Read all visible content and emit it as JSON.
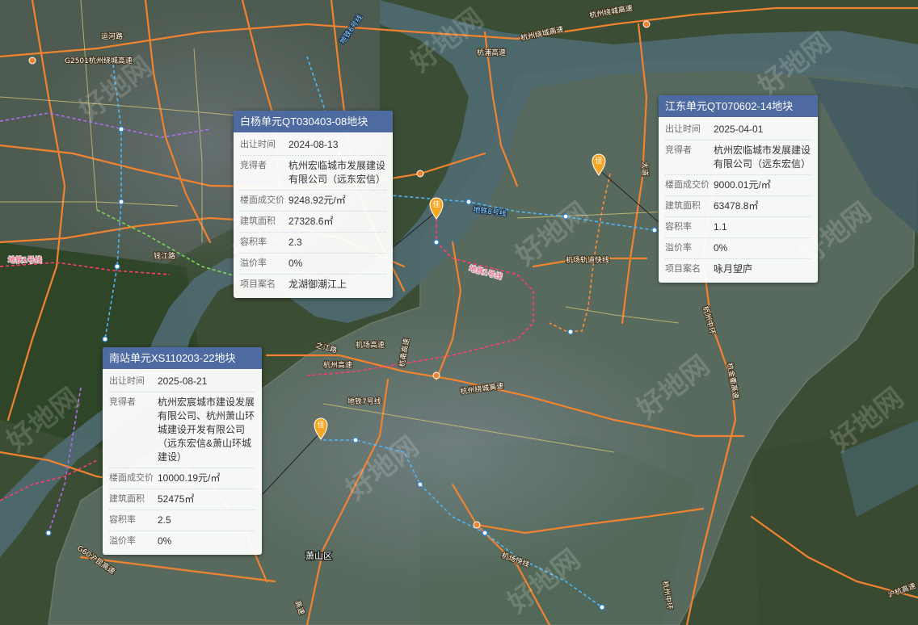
{
  "map": {
    "watermark_text": "好地网",
    "district_label": "萧山区",
    "road_labels": [
      "运河路",
      "G2501杭州绕城高速",
      "杭州绕城高速",
      "杭浦高速",
      "杭州绕城高速",
      "大道",
      "之江路",
      "机场高速",
      "机场轨道快线",
      "杭州高速",
      "杭甬高速",
      "杭州绕城高速",
      "地铁7号线",
      "钱江路",
      "杭州中环",
      "杭金衢高速",
      "机场快线",
      "G60沪昆高速",
      "杭州中环",
      "高速",
      "沪杭高速"
    ],
    "rail_labels": [
      "地铁1号线",
      "地铁1号线"
    ],
    "metro_labels": [
      "地铁8号线",
      "地铁6号线"
    ],
    "pin_glyph": "佳",
    "colors": {
      "highway": "#f0832f",
      "metro_pink": "#ff3d6e",
      "metro_blue": "#4fb7f5",
      "popup_header": "#4d6aa1"
    }
  },
  "popups": {
    "baiyang": {
      "title": "白杨单元QT030403-08地块",
      "rows": [
        {
          "label": "出让时间",
          "value": "2024-08-13"
        },
        {
          "label": "竞得者",
          "value": "杭州宏临城市发展建设有限公司（远东宏信）"
        },
        {
          "label": "楼面成交价",
          "value": "9248.92元/㎡"
        },
        {
          "label": "建筑面积",
          "value": "27328.6㎡"
        },
        {
          "label": "容积率",
          "value": "2.3"
        },
        {
          "label": "溢价率",
          "value": "0%"
        },
        {
          "label": "项目案名",
          "value": "龙湖御潮江上"
        }
      ]
    },
    "jiangdong": {
      "title": "江东单元QT070602-14地块",
      "rows": [
        {
          "label": "出让时间",
          "value": "2025-04-01"
        },
        {
          "label": "竞得者",
          "value": "杭州宏临城市发展建设有限公司（远东宏信）"
        },
        {
          "label": "楼面成交价",
          "value": "9000.01元/㎡"
        },
        {
          "label": "建筑面积",
          "value": "63478.8㎡"
        },
        {
          "label": "容积率",
          "value": "1.1"
        },
        {
          "label": "溢价率",
          "value": "0%"
        },
        {
          "label": "项目案名",
          "value": "咏月望庐"
        }
      ]
    },
    "nanzhan": {
      "title": "南站单元XS110203-22地块",
      "rows": [
        {
          "label": "出让时间",
          "value": "2025-08-21"
        },
        {
          "label": "竞得者",
          "value": "杭州宏宸城市建设发展有限公司、杭州萧山环城建设开发有限公司（远东宏信&萧山环城建设）"
        },
        {
          "label": "楼面成交价",
          "value": "10000.19元/㎡"
        },
        {
          "label": "建筑面积",
          "value": "52475㎡"
        },
        {
          "label": "容积率",
          "value": "2.5"
        },
        {
          "label": "溢价率",
          "value": "0%"
        }
      ]
    }
  }
}
